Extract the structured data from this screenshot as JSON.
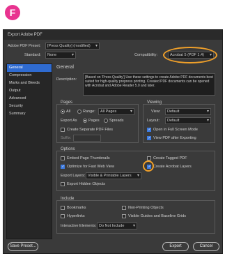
{
  "badge": "F",
  "window": {
    "title": "Export Adobe PDF"
  },
  "top": {
    "preset_label": "Adobe PDF Preset:",
    "preset_value": "[Press Quality] (modified)",
    "standard_label": "Standard:",
    "standard_value": "None",
    "compat_label": "Compatibility:",
    "compat_value": "Acrobat 5 (PDF 1.4)"
  },
  "sidebar": {
    "items": [
      {
        "label": "General",
        "active": true
      },
      {
        "label": "Compression",
        "active": false
      },
      {
        "label": "Marks and Bleeds",
        "active": false
      },
      {
        "label": "Output",
        "active": false
      },
      {
        "label": "Advanced",
        "active": false
      },
      {
        "label": "Security",
        "active": false
      },
      {
        "label": "Summary",
        "active": false
      }
    ]
  },
  "panel": {
    "heading": "General",
    "description_label": "Description:",
    "description_text": "[Based on 'Press Quality'] Use these settings to create Adobe PDF documents best suited for high-quality prepress printing. Created PDF documents can be opened with Acrobat and Adobe Reader 5.0 and later."
  },
  "pages": {
    "title": "Pages",
    "all": "All",
    "range": "Range:",
    "range_value": "All Pages",
    "export_as": "Export As",
    "pages_opt": "Pages",
    "spreads_opt": "Spreads",
    "create_separate": "Create Separate PDF Files",
    "suffix_label": "Suffix:"
  },
  "viewing": {
    "title": "Viewing",
    "view_label": "View:",
    "view_value": "Default",
    "layout_label": "Layout:",
    "layout_value": "Default",
    "full_screen": "Open in Full Screen Mode",
    "view_after": "View PDF after Exporting"
  },
  "options": {
    "title": "Options",
    "embed_thumbs": "Embed Page Thumbnails",
    "optimize": "Optimize for Fast Web View",
    "create_tagged": "Create Tagged PDF",
    "create_acrobat_layers": "Create Acrobat Layers",
    "export_layers_label": "Export Layers:",
    "export_layers_value": "Visible & Printable Layers",
    "hyperlinks": "Export Hidden Objects"
  },
  "include": {
    "title": "Include",
    "bookmarks": "Bookmarks",
    "hyperlinks": "Hyperlinks",
    "nonprinting": "Non-Printing Objects",
    "visible_guides": "Visible Guides and Baseline Grids",
    "interactive_label": "Interactive Elements:",
    "interactive_value": "Do Not Include"
  },
  "buttons": {
    "save_preset": "Save Preset...",
    "export": "Export",
    "cancel": "Cancel"
  },
  "colors": {
    "accent": "#2f6bd0",
    "highlight": "#f0a02a",
    "badge": "#e8338f"
  }
}
